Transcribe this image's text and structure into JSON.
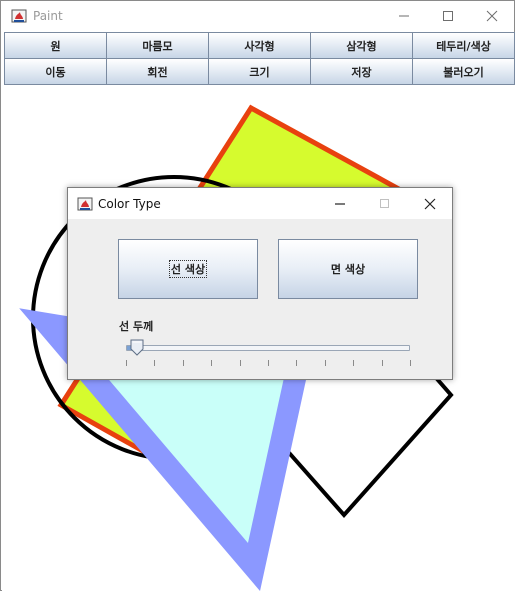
{
  "window": {
    "title": "Paint"
  },
  "toolbar": {
    "row1": [
      "원",
      "마름모",
      "사각형",
      "삼각형",
      "테두리/색상"
    ],
    "row2": [
      "이동",
      "회전",
      "크기",
      "저장",
      "불러오기"
    ]
  },
  "dialog": {
    "title": "Color Type",
    "line_color_label": "선 색상",
    "fill_color_label": "면 색상",
    "thickness_label": "선 두께",
    "slider_value_fraction": 0.04,
    "tick_count": 10
  },
  "colors": {
    "yellow_fill": "#d6fb2e",
    "orange_stroke": "#e8410f",
    "circle_stroke": "#000000",
    "triangle_stroke": "#8b98ff",
    "triangle_fill": "#c9fff9"
  }
}
